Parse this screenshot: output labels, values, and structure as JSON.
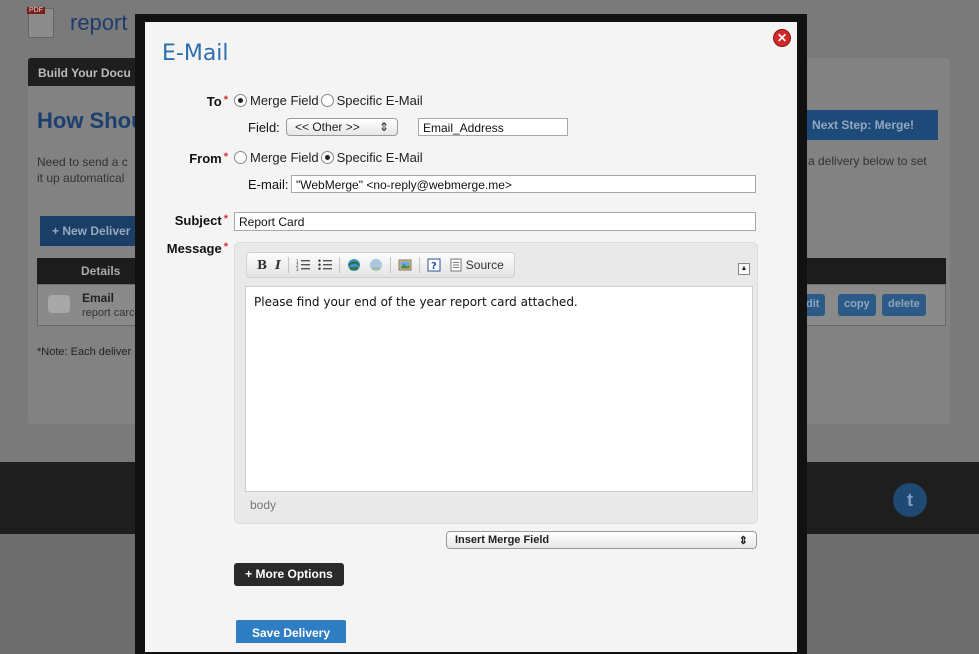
{
  "background": {
    "pdf_badge": "PDF",
    "doc_title": "report",
    "tab_label": "Build Your Docu",
    "heading": "How Shou",
    "intro_line1": "Need to send a c",
    "intro_line2": "it up automatical",
    "new_delivery_label": "+ New Deliver",
    "details_header": "Details",
    "row_title": "Email",
    "row_subtitle": "report carc",
    "note": "*Note: Each deliver",
    "next_step_label": "Next Step: Merge!",
    "right_text": "a delivery below to set",
    "row_actions": [
      "dit",
      "copy",
      "delete"
    ]
  },
  "modal": {
    "title": "E-Mail",
    "close_symbol": "✕",
    "to": {
      "label": "To",
      "required_mark": "*",
      "options": [
        "Merge Field",
        "Specific E-Mail"
      ],
      "selected": 0,
      "field_label": "Field:",
      "field_select": "<< Other >>",
      "field_value": "Email_Address"
    },
    "from": {
      "label": "From",
      "required_mark": "*",
      "options": [
        "Merge Field",
        "Specific E-Mail"
      ],
      "selected": 1,
      "email_label": "E-mail:",
      "email_value": "\"WebMerge\" <no-reply@webmerge.me>"
    },
    "subject": {
      "label": "Subject",
      "required_mark": "*",
      "value": "Report Card"
    },
    "message": {
      "label": "Message",
      "required_mark": "*",
      "toolbar": {
        "bold": "B",
        "italic": "I",
        "source": "Source"
      },
      "body": "Please find your end of the year report card attached.",
      "path": "body"
    },
    "insert_merge_field": "Insert Merge Field",
    "more_options": "+ More Options",
    "save_delivery": "Save Delivery"
  },
  "colors": {
    "accent": "#2b6fb0",
    "required": "#d13030",
    "save_button": "#2f7ec4",
    "close_button": "#d12a2a"
  }
}
